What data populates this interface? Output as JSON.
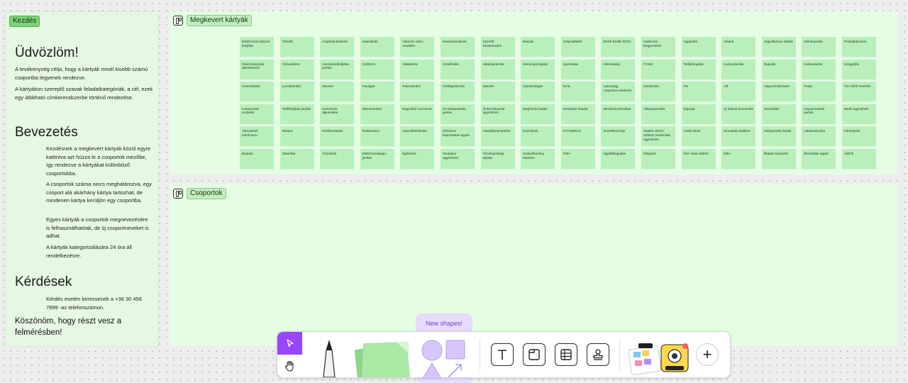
{
  "intro": {
    "tag": "Kezdés",
    "welcome_heading": "Üdvözlöm!",
    "welcome_p1": "A tevékenység célja, hogy a kártyák minél kisebb számú csoportba legyenek rendezve.",
    "welcome_p2": "A kártyákon szereplő szavak feladatkategóriák, a cél, ezek egy átlátható címkerendszerbe történő rendezése.",
    "intro_heading": "Bevezetés",
    "intro_p1": "Kezdésnek a megkevert kártyák közül egyre kattintva azt húzza le a csoportok mezőbe, így rendezve a kártyákat különböző csoportokba.",
    "intro_p2": "A csoportok száma nincs meghatározva, egy csoport alá akárhány kártya tartozhat, de mindenen kártya kerüljön egy csoportba.",
    "intro_p3": "Egyes kártyák a csoportok megnevezésére is felhasználhatóak, de új csoportneveket is adhat.",
    "intro_p4": "A kártyák kategorizálására 24 óra áll rendelkezésre.",
    "questions_heading": "Kérdések",
    "questions_p1": "Kérdés esetén keressenek a +36 30 456 7899 -as telefonszámon.",
    "thanks": "Köszönöm, hogy részt vesz a felmérésben!"
  },
  "frames": {
    "shuffled_title": "Megkevert kártyák",
    "groups_title": "Csoportok"
  },
  "cards": [
    "Elektromos hálózat felújítás",
    "Tűzoltó",
    "Árajánlat bekérés",
    "számlázás",
    "Úttorozó vétel, rendelés",
    "Kamerarendszer",
    "Szerelő összeszedés",
    "Beázás",
    "Helymátfütés",
    "MVM/ ELMŰ /EON",
    "Határozat kiegyeztetés",
    "Ágaprítás",
    "Viaduk",
    "Jegyzőkönyv iktatás",
    "Kéményszás",
    "Postaládacsere",
    "Önkormányzati átbeérkezés",
    "Tűzvédelem",
    "Homlokzatfelújítás, javítás",
    "Csőtörés",
    "Ablaktörés",
    "Ázsitűrülés",
    "Hibabejelentés",
    "Kéményvizsgálat",
    "nyomtatás",
    "Hőszivattyú",
    "FCSM",
    "Tetőkiforgalás",
    "Kulcsmásolás",
    "Dugulás",
    "Karbantartás",
    "Közgyűlés",
    "Üzemeltetés",
    "Lomtalanítás",
    "Internet",
    "Favágás",
    "Rokonkedés",
    "Hőelligenkezés",
    "Internet",
    "Gázszivárgás",
    "MÁK",
    "Lakossági, csoportos rendezés",
    "Kivitelezés",
    "Per",
    "Lift",
    "Alapvezetékcsere",
    "Posta",
    "Víz mérő/ hevérés",
    "Kukamosás rendelés",
    "Tetőfelújítás/ javítás",
    "Közművek átjelentése",
    "Mészmeretés",
    "Bogcsíkó/ novenirás",
    "Cs karbantartás, javítás",
    "Önkormányzati ügyintézés",
    "Meghívók kiadás",
    "Kerékpári feladat",
    "Mérőórák jelentése",
    "Villanyszerelés",
    "Elgurad",
    "Új házirut bevezetés",
    "Szerződés",
    "Kapuszerelési javítás",
    "Banki ügyintézés",
    "Társasházi mérőcsere",
    "Rámpa",
    "Kertfenntartás",
    "Reklamáció",
    "Lépcsőházfestés",
    "Kőműves kapcsolatos ügyek",
    "Akadálymentesítés",
    "Közművek",
    "FATÁMOHU",
    "Vezetékcseréje",
    "Alapító okirat / SZMSZ módosítás, ügyintézés",
    "csekk kiírás",
    "Kimutatás küldése",
    "Hidegrentés-átválá",
    "Lakatosmunka",
    "Fűmetszés",
    "Bejárás",
    "Takarítás",
    "Vízművek",
    "Elektromoskapu-javítás",
    "Égőcsere",
    "Hivatalos ügyintézés",
    "Törvényességi eljárás",
    "Szakvélemény bekérés",
    "FMH",
    "Ügyféltárgyalás",
    "Pályázat",
    "FKF-zsák rátérés",
    "DBH",
    "Iktatott szavazás",
    "Biztosítási ügyek",
    "Airbnb"
  ],
  "toolbar": {
    "new_shapes_label": "New shapes!",
    "plus_label": "+"
  }
}
